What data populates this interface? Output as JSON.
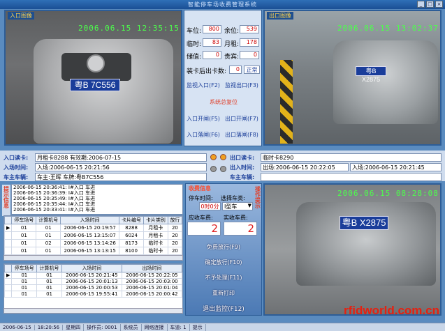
{
  "app": {
    "title": "智能停车场收费管理系统"
  },
  "cams": {
    "entry": {
      "label": "入口图像",
      "timestamp": "2006.06.15 12:35:15",
      "plate": "粤B 7C556"
    },
    "exit": {
      "label": "出口图像",
      "timestamp": "2006.06.15 13:02:37",
      "plate": "粤B X2875"
    },
    "snap": {
      "timestamp": "2006.06.15 08:28:08",
      "plate": "粤B X2875"
    }
  },
  "center": {
    "stats": [
      {
        "label": "车位:",
        "value": "800"
      },
      {
        "label": "余位:",
        "value": "539"
      },
      {
        "label": "临时:",
        "value": "83"
      },
      {
        "label": "月租:",
        "value": "178"
      },
      {
        "label": "储值:",
        "value": "0"
      },
      {
        "label": "贵宾:",
        "value": "0"
      }
    ],
    "card_count_label": "装卡后出卡数:",
    "card_count_value": "0",
    "card_status": "正常",
    "monitor_in": "监视入口(F2)",
    "monitor_out": "监视出口(F3)",
    "reset": "系统总复位",
    "in_open": "入口开闸(F5)",
    "out_open": "出口开闸(F7)",
    "in_close": "入口落闸(F6)",
    "out_close": "出口落闸(F8)"
  },
  "info": {
    "in_card_label": "入口读卡:",
    "in_card_value": "月租卡8288 有效期:2006-07-15",
    "in_time_label": "入场时间:",
    "in_time_value": "入场:2006-06-15 20:21:56",
    "owner_label": "车主车辆:",
    "owner_value": "车主:王晖  车牌:粤B7C556",
    "out_card_label": "出口读卡:",
    "out_card_value": "临时卡8290",
    "out_time_label": "出入时间:",
    "out_time_value1": "出场:2006-06-15 20:22:05",
    "out_time_value2": "入场:2006-06-15 20:21:45",
    "out_owner_label": "车主车辆:"
  },
  "log": {
    "side_label": "提示信息",
    "entries": [
      "2006-06-15 20:36:41: I#入口 车进",
      "2006-06-15 20:36:39: I#入口 车进",
      "2006-06-15 20:35:49: I#入口 车进",
      "2006-06-15 20:35:44: I#入口 车进",
      "2006-06-15 20:33:41: I#入口 车进"
    ]
  },
  "table1": {
    "headers": [
      "停车场号",
      "计算机号",
      "入场时间",
      "卡片编号",
      "卡片类别",
      "放行"
    ],
    "rows": [
      [
        "01",
        "01",
        "2006-06-15 20:19:57",
        "8288",
        "月租卡",
        "20"
      ],
      [
        "01",
        "01",
        "2006-06-15 13:15:07",
        "6024",
        "月租卡",
        "20"
      ],
      [
        "01",
        "02",
        "2006-06-15 13:14:26",
        "8173",
        "临时卡",
        "20"
      ],
      [
        "01",
        "01",
        "2006-06-15 13:13:15",
        "8100",
        "临时卡",
        "20"
      ]
    ]
  },
  "table2": {
    "headers": [
      "停车场号",
      "计算机号",
      "入场时间",
      "出场时间"
    ],
    "rows": [
      [
        "01",
        "01",
        "2006-06-15 20:21:45",
        "2006-06-15 20:22:05"
      ],
      [
        "01",
        "01",
        "2006-06-15 20:01:13",
        "2006-06-15 20:03:00"
      ],
      [
        "01",
        "01",
        "2006-06-15 20:00:53",
        "2006-06-15 20:01:04"
      ],
      [
        "01",
        "01",
        "2006-06-15 19:55:41",
        "2006-06-15 20:00:42"
      ]
    ]
  },
  "fee": {
    "title": "收费信息",
    "park_time_label": "停车时间:",
    "park_time_value": "0时0分",
    "type_label": "选择车类:",
    "type_value": "I型车",
    "due_label": "应收车费:",
    "due_value": "2",
    "paid_label": "实收车费:",
    "paid_value": "2",
    "side_label": "操作提示",
    "btn_free": "免费放行(F9)",
    "btn_confirm": "确定放行(F10)",
    "btn_skip": "不予处理(F11)",
    "btn_reprint": "重新打印",
    "btn_exit": "退出监控(F12)"
  },
  "status": {
    "items": [
      "2006-06-15",
      "18:20:56",
      "星期四",
      "操作员: 0001",
      "系统员",
      "网络连接",
      "车道: 1",
      "提示"
    ]
  },
  "watermark": "rfidworld.com.cn"
}
